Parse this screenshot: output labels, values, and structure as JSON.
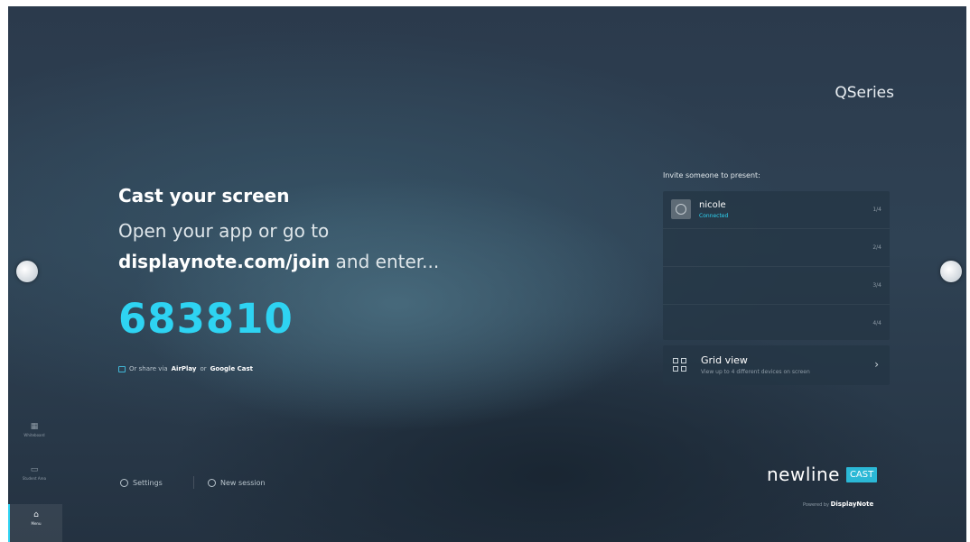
{
  "brand_name": "QSeries",
  "main": {
    "title": "Cast your screen",
    "instruction_line1": "Open your app or go to",
    "join_url": "displaynote.com/join",
    "instruction_suffix": " and enter...",
    "code": "683810",
    "share_prefix": "Or share via ",
    "share_airplay": "AirPlay",
    "share_or": " or ",
    "share_google": "Google Cast"
  },
  "invite": {
    "heading": "Invite someone to present:",
    "slots": [
      {
        "name": "nicole",
        "status": "Connected",
        "index": "1/4"
      },
      {
        "name": "",
        "status": "",
        "index": "2/4"
      },
      {
        "name": "",
        "status": "",
        "index": "3/4"
      },
      {
        "name": "",
        "status": "",
        "index": "4/4"
      }
    ],
    "grid_view": {
      "title": "Grid view",
      "subtitle": "View up to 4 different devices on screen"
    }
  },
  "bottom": {
    "settings_label": "Settings",
    "new_session_label": "New session"
  },
  "sidebar": {
    "items": [
      {
        "label": "Whiteboard",
        "icon": "whiteboard-icon"
      },
      {
        "label": "Student Area",
        "icon": "folder-icon"
      },
      {
        "label": "Menu",
        "icon": "home-icon"
      }
    ]
  },
  "logo": {
    "word": "newline",
    "badge": "CAST",
    "powered_by": "Powered by",
    "powered_brand": "DisplayNote"
  },
  "colors": {
    "accent": "#2ed3f2",
    "background": "#2f4254"
  }
}
